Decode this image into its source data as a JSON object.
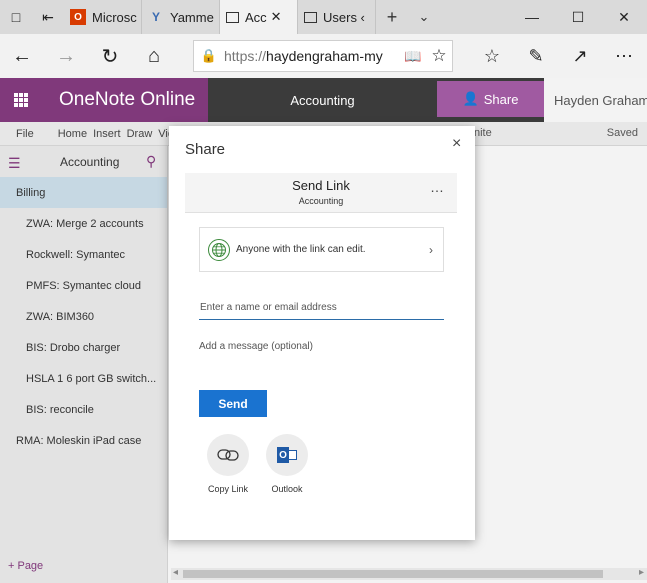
{
  "browser": {
    "tabs": [
      {
        "label": "Microsc",
        "icon": "office-icon"
      },
      {
        "label": "Yamme",
        "icon": "yammer-icon"
      },
      {
        "label": "Acc",
        "icon": "page-icon",
        "active": true
      },
      {
        "label": "Users ‹",
        "icon": "page-icon"
      }
    ],
    "url_scheme": "https://",
    "url_host": "haydengraham-my"
  },
  "app": {
    "name": "OneNote Online",
    "notebook": "Accounting",
    "share_label": "Share",
    "user_name": "Hayden Graham"
  },
  "ribbon": {
    "items": [
      "File",
      "Home",
      "Insert",
      "Draw",
      "View"
    ],
    "partial": "nite",
    "status": "Saved"
  },
  "nav": {
    "notebook": "Accounting",
    "items": [
      {
        "label": "Billing",
        "kind": "section",
        "selected": true
      },
      {
        "label": "ZWA: Merge 2 accounts",
        "kind": "page"
      },
      {
        "label": "Rockwell: Symantec",
        "kind": "page"
      },
      {
        "label": "PMFS: Symantec cloud",
        "kind": "page"
      },
      {
        "label": "ZWA: BIM360",
        "kind": "page"
      },
      {
        "label": "BIS: Drobo charger",
        "kind": "page"
      },
      {
        "label": "HSLA 1 6 port GB switch...",
        "kind": "page"
      },
      {
        "label": "BIS: reconcile",
        "kind": "page"
      },
      {
        "label": "RMA: Moleskin iPad case",
        "kind": "section"
      }
    ],
    "add_page": "+ Page"
  },
  "dialog": {
    "title": "Share",
    "close": "×",
    "send_link_title": "Send Link",
    "send_link_subtitle": "Accounting",
    "more": "…",
    "permission": "Anyone with the link can edit.",
    "name_placeholder": "Enter a name or email address",
    "message_placeholder": "Add a message (optional)",
    "send_label": "Send",
    "copy_link_label": "Copy Link",
    "outlook_label": "Outlook"
  },
  "colors": {
    "onenote_purple": "#80397b",
    "share_purple": "#a05aa1",
    "send_blue": "#1a73d0",
    "selected_nav": "#c6d8e3"
  }
}
